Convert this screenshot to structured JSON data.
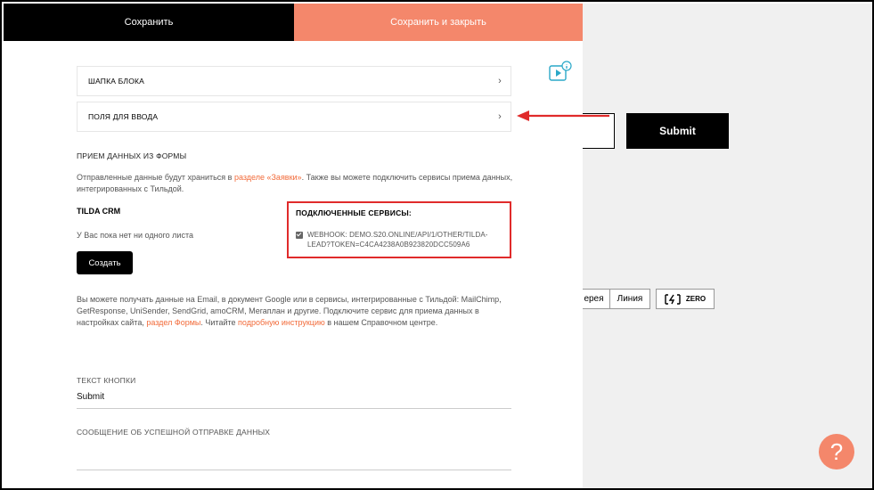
{
  "topbar": {
    "save_label": "Сохранить",
    "save_close_label": "Сохранить и закрыть"
  },
  "accordion": {
    "header_label": "ШАПКА БЛОКА",
    "fields_label": "ПОЛЯ ДЛЯ ВВОДА"
  },
  "form_data": {
    "section_title": "ПРИЕМ ДАННЫХ ИЗ ФОРМЫ",
    "desc_before": "Отправленные данные будут храниться в ",
    "desc_link": "разделе «Заявки»",
    "desc_after": ". Также вы можете подключить сервисы приема данных, интегрированных с Тильдой."
  },
  "crm": {
    "title": "TILDA CRM",
    "empty_text": "У Вас пока нет ни одного листа",
    "create_label": "Создать"
  },
  "services": {
    "title": "ПОДКЛЮЧЕННЫЕ СЕРВИСЫ:",
    "items": [
      {
        "label": "WEBHOOK: DEMO.S20.ONLINE/API/1/OTHER/TILDA-LEAD?TOKEN=C4CA4238A0B923820DCC509A6",
        "checked": true
      }
    ]
  },
  "info": {
    "part1": "Вы можете получать данные на Email, в документ Google или в сервисы, интегрированные с Тильдой: MailChimp, GetResponse, UniSender, SendGrid, amoCRM, Мегаплан и другие. Подключите сервис для приема данных в настройках сайта, ",
    "link1": "раздел Формы",
    "part2": ". Читайте ",
    "link2": "подробную инструкцию",
    "part3": " в нашем Справочном центре."
  },
  "button_text": {
    "label": "ТЕКСТ КНОПКИ",
    "value": "Submit"
  },
  "success_message": {
    "label": "СООБЩЕНИЕ ОБ УСПЕШНОЙ ОТПРАВКЕ ДАННЫХ"
  },
  "background": {
    "submit_label": "Submit",
    "gallery_label": "ерея",
    "line_label": "Линия",
    "zero_label": "ZERO",
    "help_label": "?"
  },
  "colors": {
    "accent": "#f4876b",
    "link": "#f26b3a",
    "highlight": "#e02b2b"
  },
  "icons": [
    "video-info-icon",
    "chevron-right-icon",
    "zero-block-icon",
    "help-icon"
  ]
}
